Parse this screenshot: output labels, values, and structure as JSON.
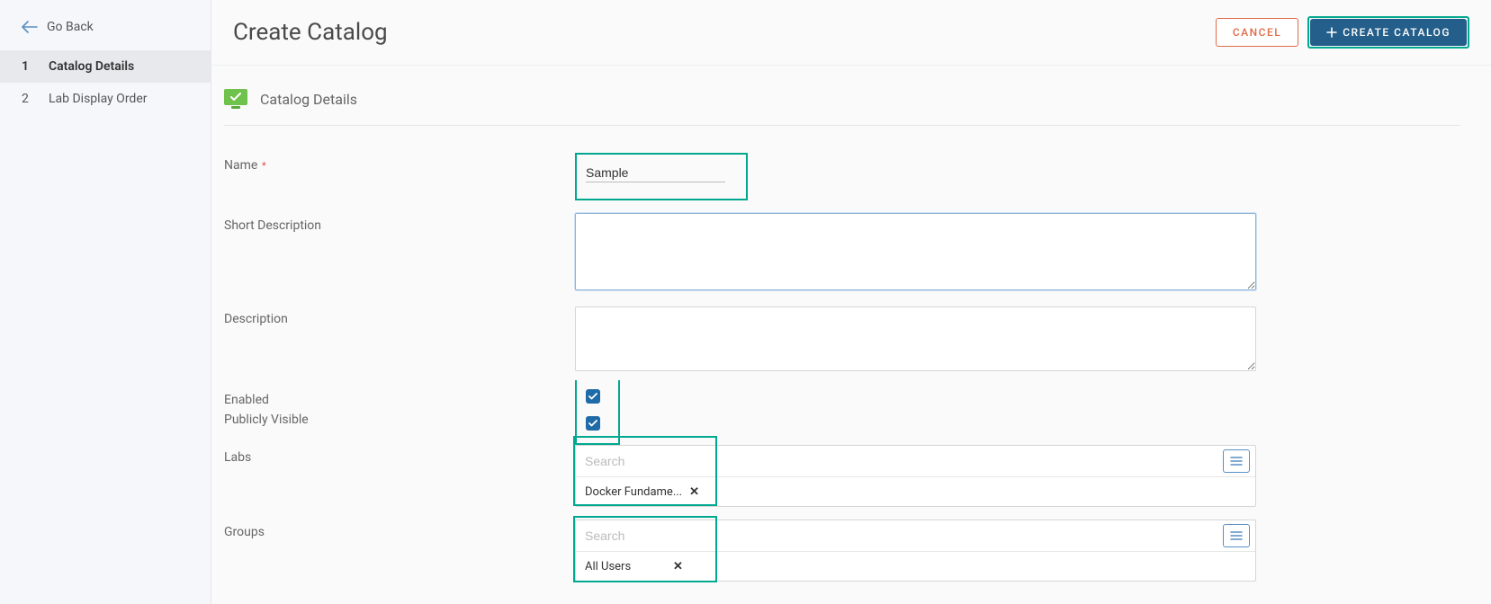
{
  "sidebar": {
    "go_back": "Go Back",
    "steps": [
      {
        "num": "1",
        "label": "Catalog Details",
        "active": true
      },
      {
        "num": "2",
        "label": "Lab Display Order",
        "active": false
      }
    ]
  },
  "header": {
    "title": "Create Catalog",
    "cancel": "CANCEL",
    "create": "CREATE CATALOG"
  },
  "section": {
    "title": "Catalog Details"
  },
  "form": {
    "name_label": "Name",
    "name_value": "Sample",
    "short_desc_label": "Short Description",
    "short_desc_value": "",
    "desc_label": "Description",
    "desc_value": "",
    "enabled_label": "Enabled",
    "enabled_checked": true,
    "public_label": "Publicly Visible",
    "public_checked": true,
    "labs_label": "Labs",
    "labs_search_placeholder": "Search",
    "labs_selected": "Docker Fundame...",
    "groups_label": "Groups",
    "groups_search_placeholder": "Search",
    "groups_selected": "All Users"
  }
}
